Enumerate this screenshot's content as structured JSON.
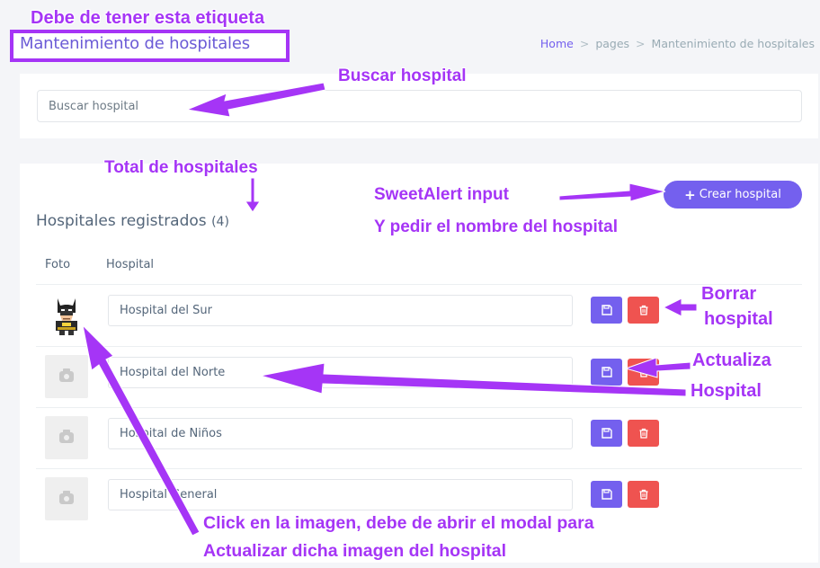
{
  "header": {
    "title": "Mantenimiento de hospitales",
    "breadcrumb": {
      "home": "Home",
      "pages": "pages",
      "current": "Mantenimiento de hospitales"
    }
  },
  "search": {
    "placeholder": "Buscar hospital"
  },
  "list": {
    "title": "Hospitales registrados",
    "count_open": "(",
    "count": "4",
    "count_close": ")",
    "create_label": "Crear hospital",
    "columns": {
      "photo": "Foto",
      "hospital": "Hospital"
    },
    "rows": [
      {
        "name": "Hospital del Sur",
        "photo": "batman-avatar"
      },
      {
        "name": "Hospital del Norte",
        "photo": "no-image"
      },
      {
        "name": "Hospital de Niños",
        "photo": "no-image"
      },
      {
        "name": "Hospital General",
        "photo": "no-image"
      }
    ]
  },
  "annotations": {
    "label_note": "Debe de tener esta etiqueta",
    "search_note": "Buscar hospital",
    "total_note": "Total de hospitales",
    "sweetalert_line1": "SweetAlert input",
    "sweetalert_line2": "Y pedir el nombre del hospital",
    "delete_line1": "Borrar",
    "delete_line2": "hospital",
    "update_line1": "Actualiza",
    "update_line2": "Hospital",
    "image_line1": "Click en la imagen, debe de abrir el modal para",
    "image_line2": "Actualizar dicha imagen del hospital"
  },
  "colors": {
    "accent": "#7460ee",
    "danger": "#ef5350",
    "annotation": "#a535f6"
  },
  "icons": {
    "save": "save-icon",
    "delete": "trash-icon",
    "plus": "plus-icon",
    "camera": "camera-icon"
  }
}
